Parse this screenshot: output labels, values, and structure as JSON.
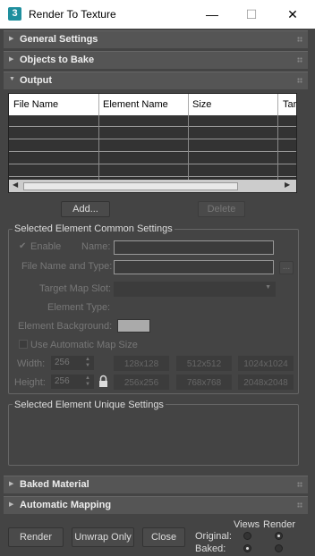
{
  "window": {
    "title": "Render To Texture",
    "app_icon_text": "3"
  },
  "rollouts": {
    "general": "General Settings",
    "objects": "Objects to Bake",
    "output": "Output",
    "baked_material": "Baked Material",
    "auto_mapping": "Automatic Mapping"
  },
  "table": {
    "columns": [
      "File Name",
      "Element Name",
      "Size",
      "Targ"
    ],
    "rows": 5
  },
  "buttons": {
    "add": "Add...",
    "delete": "Delete"
  },
  "common": {
    "title": "Selected Element Common Settings",
    "enable": "Enable",
    "name": "Name:",
    "file_name_type": "File Name and Type:",
    "browse": "...",
    "target_map_slot": "Target Map Slot:",
    "element_type": "Element Type:",
    "element_background": "Element Background:",
    "use_auto_map_size": "Use Automatic Map Size",
    "width": "Width:",
    "height": "Height:",
    "width_value": "256",
    "height_value": "256",
    "sizes_row1": [
      "128x128",
      "512x512",
      "1024x1024"
    ],
    "sizes_row2": [
      "256x256",
      "768x768",
      "2048x2048"
    ]
  },
  "unique": {
    "title": "Selected Element Unique Settings"
  },
  "footer": {
    "render": "Render",
    "unwrap_only": "Unwrap Only",
    "close": "Close",
    "views": "Views",
    "render_col": "Render",
    "original": "Original:",
    "baked": "Baked:"
  }
}
